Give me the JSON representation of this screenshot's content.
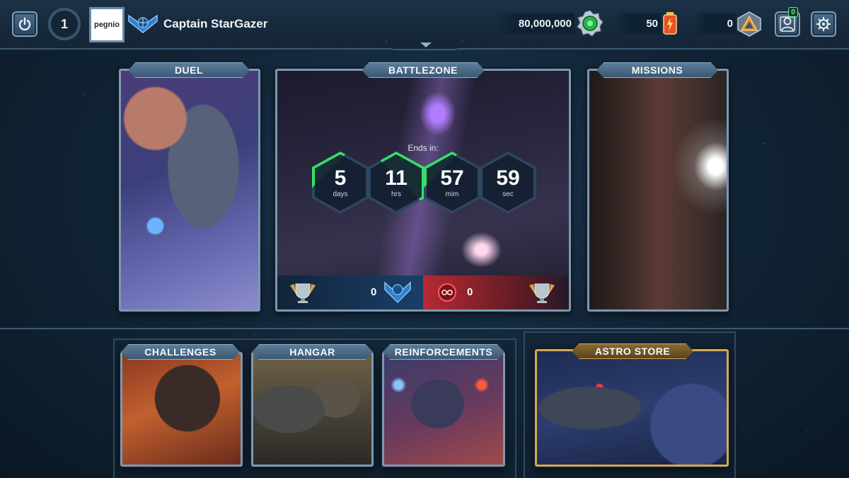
{
  "player": {
    "level": "1",
    "name": "Captain StarGazer",
    "avatar_text": "pegnio"
  },
  "currencies": {
    "credits": "80,000,000",
    "energy": "50",
    "medals": "0"
  },
  "notifications": {
    "friends_count": "0"
  },
  "panels": {
    "duel": {
      "label": "DUEL"
    },
    "battlezone": {
      "label": "BATTLEZONE",
      "ends_in_label": "Ends in:",
      "timer": {
        "days_value": "5",
        "days_unit": "days",
        "hrs_value": "11",
        "hrs_unit": "hrs",
        "min_value": "57",
        "min_unit": "mim",
        "sec_value": "59",
        "sec_unit": "sec"
      },
      "score_blue": "0",
      "score_red": "0"
    },
    "missions": {
      "label": "MISSIONS"
    },
    "challenges": {
      "label": "CHALLENGES"
    },
    "hangar": {
      "label": "HANGAR"
    },
    "reinforcements": {
      "label": "REINFORCEMENTS"
    },
    "astro_store": {
      "label": "ASTRO STORE"
    }
  },
  "colors": {
    "accent_green": "#35e06a",
    "team_red": "#b82a33",
    "team_blue": "#1a3f68",
    "store_gold": "#d8a656"
  },
  "icons": {
    "power": "power-icon",
    "rank": "rank-chevron-icon",
    "credits": "gear-credit-icon",
    "energy": "energy-cell-icon",
    "medals": "triangle-medal-icon",
    "friends": "friends-icon",
    "settings": "settings-icon",
    "trophy": "trophy-icon",
    "infinity": "infinity-emblem-icon"
  }
}
